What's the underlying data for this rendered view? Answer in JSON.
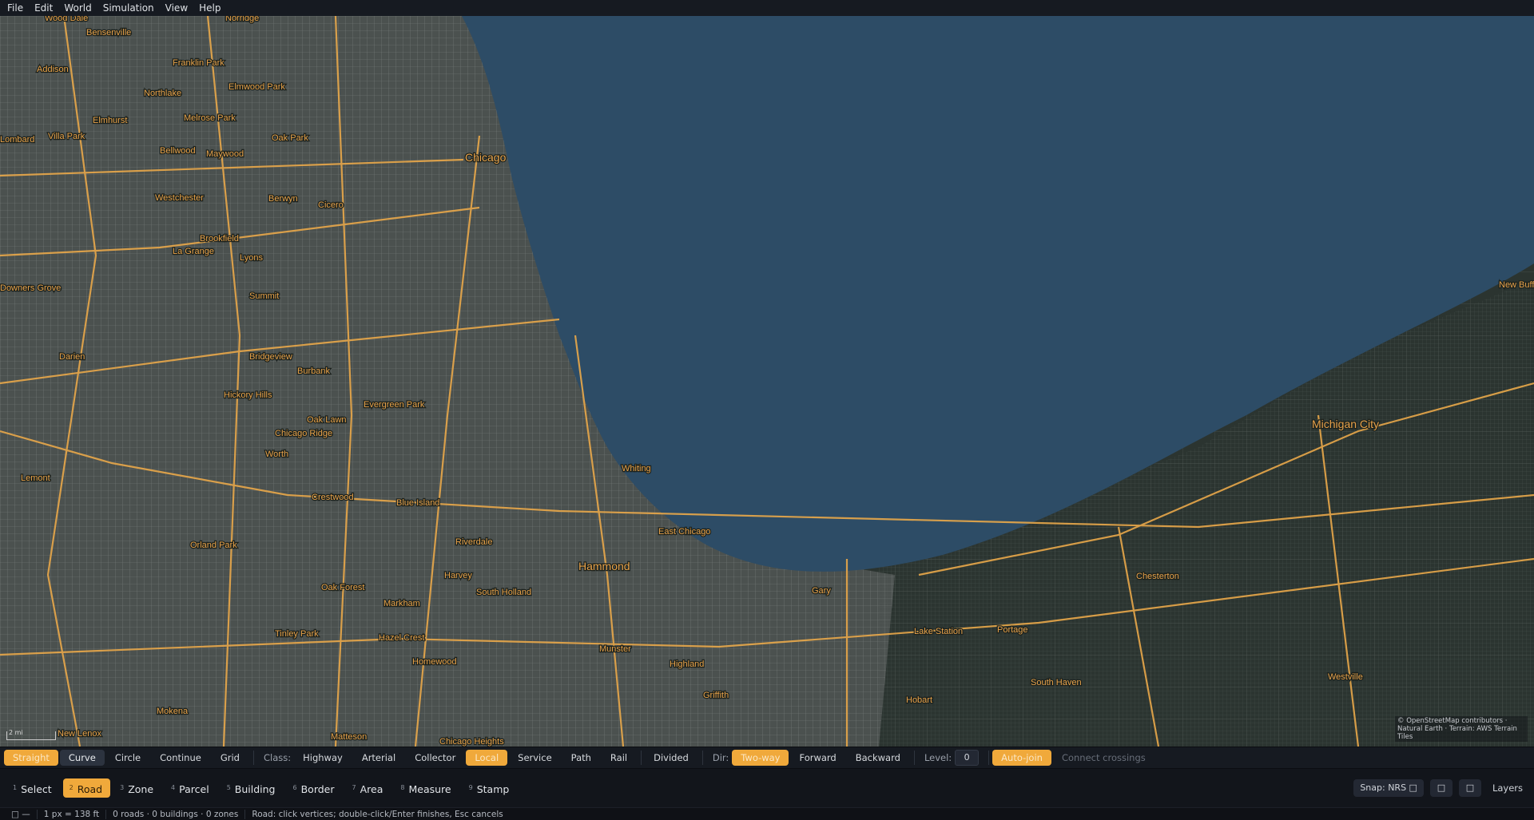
{
  "menu": [
    "File",
    "Edit",
    "World",
    "Simulation",
    "View",
    "Help"
  ],
  "map": {
    "colors": {
      "water": "#2d4c66",
      "land": "#2b3430",
      "urban": "#4e5552",
      "highway": "#e9a84a",
      "label": "#e7a24b"
    },
    "places": [
      "Wood Dale",
      "Norridge",
      "Bensenville",
      "Addison",
      "Franklin Park",
      "Northlake",
      "Elmwood Park",
      "Elmhurst",
      "Melrose Park",
      "Villa Park",
      "Lombard",
      "Oak Park",
      "Chicago",
      "Bellwood",
      "Maywood",
      "Westchester",
      "Berwyn",
      "Cicero",
      "Brookfield",
      "La Grange",
      "Lyons",
      "Downers Grove",
      "Summit",
      "Oak Lawn",
      "Bridgeview",
      "Burbank",
      "Darien",
      "Hickory Hills",
      "Evergreen Park",
      "Chicago Ridge",
      "Worth",
      "Lemont",
      "Crestwood",
      "Blue Island",
      "Whiting",
      "East Chicago",
      "Riverdale",
      "Hammond",
      "Orland Park",
      "Harvey",
      "Oak Forest",
      "South Holland",
      "Markham",
      "Gary",
      "Tinley Park",
      "Hazel Crest",
      "Munster",
      "Lake Station",
      "Portage",
      "Homewood",
      "Highland",
      "Griffith",
      "Hobart",
      "South Haven",
      "Chesterton",
      "Westville",
      "Michigan City",
      "New Buff",
      "Mokena",
      "New Lenox",
      "Matteson",
      "Chicago Heights"
    ],
    "scale_label": "2 mi",
    "attribution": "© OpenStreetMap contributors · Natural Earth · Terrain: AWS Terrain Tiles"
  },
  "toolbar": {
    "modes": [
      "Straight",
      "Curve",
      "Circle",
      "Continue",
      "Grid"
    ],
    "active_mode": "Straight",
    "selected_mode": "Curve",
    "class_label": "Class:",
    "classes": [
      "Highway",
      "Arterial",
      "Collector",
      "Local",
      "Service",
      "Path",
      "Rail"
    ],
    "active_class": "Local",
    "divided": "Divided",
    "dir_label": "Dir:",
    "directions": [
      "Two-way",
      "Forward",
      "Backward"
    ],
    "active_direction": "Two-way",
    "level_label": "Level:",
    "level_value": "0",
    "auto_join": "Auto-join",
    "connect_crossings": "Connect crossings"
  },
  "tools": [
    {
      "key": "1",
      "label": "Select"
    },
    {
      "key": "2",
      "label": "Road"
    },
    {
      "key": "3",
      "label": "Zone"
    },
    {
      "key": "4",
      "label": "Parcel"
    },
    {
      "key": "5",
      "label": "Building"
    },
    {
      "key": "6",
      "label": "Border"
    },
    {
      "key": "7",
      "label": "Area"
    },
    {
      "key": "8",
      "label": "Measure"
    },
    {
      "key": "9",
      "label": "Stamp"
    }
  ],
  "active_tool": "Road",
  "right_controls": {
    "snap": "Snap: NRS □",
    "btn_a": "□",
    "btn_b": "□",
    "layers": "Layers"
  },
  "status": {
    "indicator": "□ —",
    "scale": "1 px = 138 ft",
    "counts": "0 roads · 0 buildings · 0 zones",
    "hint": "Road: click vertices; double-click/Enter finishes, Esc cancels"
  }
}
